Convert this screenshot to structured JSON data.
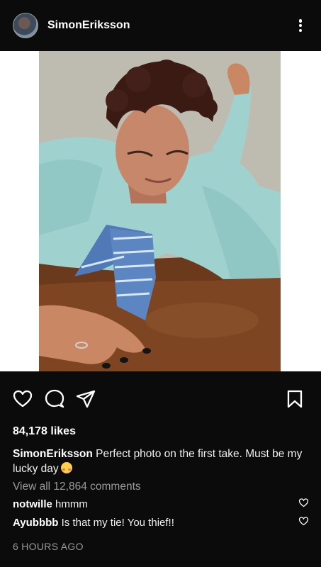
{
  "post": {
    "username": "SimonEriksson",
    "likes": "84,178 likes",
    "caption_user": "SimonEriksson",
    "caption_text": "Perfect photo on the first take. Must be my lucky day",
    "caption_emoji": "smiling-face-with-hearts-emoji",
    "view_comments": "View all 12,864 comments",
    "comments": [
      {
        "user": "notwille",
        "text": "hmmm"
      },
      {
        "user": "Ayubbbb",
        "text": "Is that my tie! You thief!!"
      }
    ],
    "time": "6 HOURS AGO"
  },
  "icons": {
    "more": "more-vertical-icon",
    "like": "heart-icon",
    "comment": "comment-icon",
    "share": "send-icon",
    "save": "bookmark-icon"
  },
  "colors": {
    "background": "#0b0b0b",
    "text": "#ffffff",
    "muted": "#9a9a9a"
  }
}
